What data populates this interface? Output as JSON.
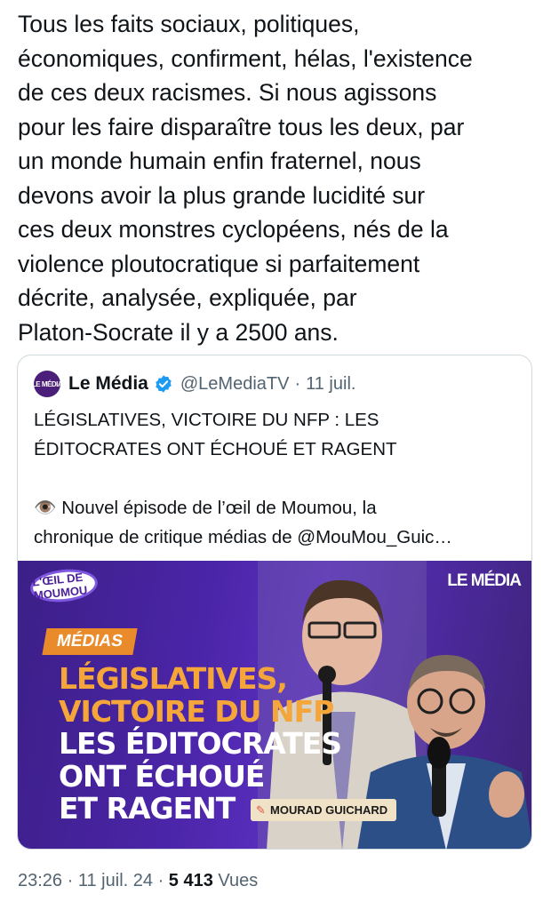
{
  "tweet": {
    "text_lines": [
      "Tous les faits sociaux, politiques,",
      "économiques, confirment, hélas, l'existence",
      "de ces deux racismes. Si nous agissons",
      "pour les faire disparaître tous les deux, par",
      "un monde humain enfin fraternel, nous",
      "devons avoir la plus grande lucidité sur",
      "ces deux monstres cyclopéens, nés de la",
      "violence ploutocratique si parfaitement",
      "décrite, analysée, expliquée, par",
      "Platon-Socrate il y a 2500 ans."
    ],
    "time": "23:26",
    "date": "11 juil. 24",
    "views_count": "5 413",
    "views_label": "Vues",
    "separator": "·"
  },
  "quote": {
    "avatar_text": "LE MÉDIA",
    "name": "Le Média",
    "handle": "@LeMediaTV",
    "separator": "·",
    "date": "11 juil.",
    "verified_color": "#1d9bf0",
    "body_lines": [
      "LÉGISLATIVES, VICTOIRE DU NFP : LES",
      "ÉDITOCRATES ONT ÉCHOUÉ ET RAGENT"
    ],
    "body_lines_2": [
      "👁️ Nouvel épisode de l’œil de Moumou, la",
      "chronique de critique médias de @MouMou_Guic…"
    ],
    "image": {
      "logo_text": "L'ŒIL DE MOUMOU",
      "brand": "LE MÉDIA",
      "tag": "MÉDIAS",
      "headline_orange": [
        "LÉGISLATIVES,",
        "VICTOIRE DU NFP"
      ],
      "headline_white": [
        "LES ÉDITOCRATES",
        "ONT ÉCHOUÉ",
        "ET RAGENT"
      ],
      "credit": "MOURAD GUICHARD",
      "colors": {
        "background": "#4b25a8",
        "tag": "#e98b2a",
        "headline_orange": "#f5a63a",
        "headline_white": "#ffffff"
      }
    }
  }
}
